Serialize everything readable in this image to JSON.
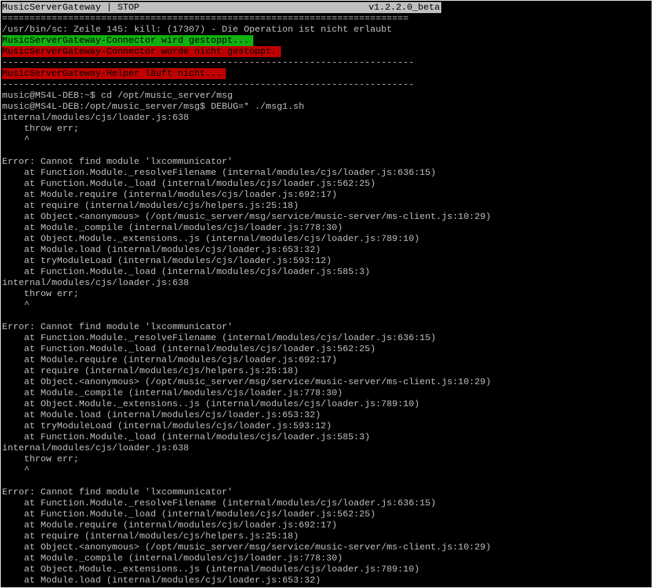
{
  "header": {
    "title": "MusicServerGateway | STOP",
    "version": "v1.2.2.0_beta"
  },
  "colors": {
    "background": "#000000",
    "text": "#c0c0c0",
    "title_bar": "#c0c0c0",
    "ok": "#10b010",
    "error": "#c00000"
  },
  "separators": {
    "double": "==========================================================================",
    "single": "---------------------------------------------------------------------------"
  },
  "status": {
    "kill_error": "/usr/bin/sc: Zeile 145: kill: (17307) - Die Operation ist nicht erlaubt",
    "connector_stopping": "MusicServerGateway-Connector wird gestoppt...",
    "connector_not_stopped": "MusicServerGateway-Connector wurde nicht gestoppt.",
    "helper_not_running": "MusicServerGateway-Helper läuft nicht..."
  },
  "shell": [
    "music@MS4L-DEB:~$ cd /opt/music_server/msg",
    "music@MS4L-DEB:/opt/music_server/msg$ DEBUG=* ./msg1.sh"
  ],
  "error_blocks": [
    {
      "header": [
        "internal/modules/cjs/loader.js:638",
        "    throw err;",
        "    ^",
        "",
        "Error: Cannot find module 'lxcommunicator'"
      ],
      "stack": [
        "    at Function.Module._resolveFilename (internal/modules/cjs/loader.js:636:15)",
        "    at Function.Module._load (internal/modules/cjs/loader.js:562:25)",
        "    at Module.require (internal/modules/cjs/loader.js:692:17)",
        "    at require (internal/modules/cjs/helpers.js:25:18)",
        "    at Object.<anonymous> (/opt/music_server/msg/service/music-server/ms-client.js:10:29)",
        "    at Module._compile (internal/modules/cjs/loader.js:778:30)",
        "    at Object.Module._extensions..js (internal/modules/cjs/loader.js:789:10)",
        "    at Module.load (internal/modules/cjs/loader.js:653:32)",
        "    at tryModuleLoad (internal/modules/cjs/loader.js:593:12)",
        "    at Function.Module._load (internal/modules/cjs/loader.js:585:3)"
      ]
    },
    {
      "header": [
        "internal/modules/cjs/loader.js:638",
        "    throw err;",
        "    ^",
        "",
        "Error: Cannot find module 'lxcommunicator'"
      ],
      "stack": [
        "    at Function.Module._resolveFilename (internal/modules/cjs/loader.js:636:15)",
        "    at Function.Module._load (internal/modules/cjs/loader.js:562:25)",
        "    at Module.require (internal/modules/cjs/loader.js:692:17)",
        "    at require (internal/modules/cjs/helpers.js:25:18)",
        "    at Object.<anonymous> (/opt/music_server/msg/service/music-server/ms-client.js:10:29)",
        "    at Module._compile (internal/modules/cjs/loader.js:778:30)",
        "    at Object.Module._extensions..js (internal/modules/cjs/loader.js:789:10)",
        "    at Module.load (internal/modules/cjs/loader.js:653:32)",
        "    at tryModuleLoad (internal/modules/cjs/loader.js:593:12)",
        "    at Function.Module._load (internal/modules/cjs/loader.js:585:3)"
      ]
    },
    {
      "header": [
        "internal/modules/cjs/loader.js:638",
        "    throw err;",
        "    ^",
        "",
        "Error: Cannot find module 'lxcommunicator'"
      ],
      "stack": [
        "    at Function.Module._resolveFilename (internal/modules/cjs/loader.js:636:15)",
        "    at Function.Module._load (internal/modules/cjs/loader.js:562:25)",
        "    at Module.require (internal/modules/cjs/loader.js:692:17)",
        "    at require (internal/modules/cjs/helpers.js:25:18)",
        "    at Object.<anonymous> (/opt/music_server/msg/service/music-server/ms-client.js:10:29)",
        "    at Module._compile (internal/modules/cjs/loader.js:778:30)",
        "    at Object.Module._extensions..js (internal/modules/cjs/loader.js:789:10)",
        "    at Module.load (internal/modules/cjs/loader.js:653:32)"
      ]
    }
  ]
}
